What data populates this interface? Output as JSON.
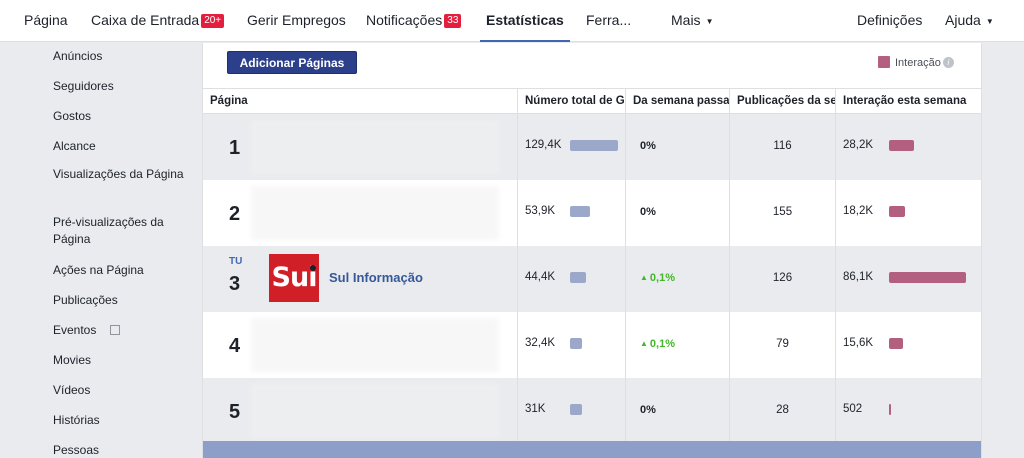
{
  "nav": {
    "items": [
      {
        "label": "Página"
      },
      {
        "label": "Caixa de Entrada",
        "badge": "20+"
      },
      {
        "label": "Gerir Empregos"
      },
      {
        "label": "Notificações",
        "badge": "33"
      },
      {
        "label": "Estatísticas"
      },
      {
        "label": "Ferra..."
      },
      {
        "label": "Mais"
      },
      {
        "label": "Definições"
      },
      {
        "label": "Ajuda"
      }
    ],
    "active_color": "#4267b2",
    "badge_color": "#e41e3f"
  },
  "sidebar": {
    "items": [
      {
        "label": "Anúncios"
      },
      {
        "label": "Seguidores"
      },
      {
        "label": "Gostos"
      },
      {
        "label": "Alcance"
      },
      {
        "label": "Visualizações da Página"
      },
      {
        "label": "Pré-visualizações da Página"
      },
      {
        "label": "Ações na Página"
      },
      {
        "label": "Publicações"
      },
      {
        "label": "Eventos",
        "icon": "external-link-icon"
      },
      {
        "label": "Movies"
      },
      {
        "label": "Vídeos"
      },
      {
        "label": "Histórias"
      },
      {
        "label": "Pessoas"
      }
    ]
  },
  "main": {
    "add_button": "Adicionar Páginas",
    "legend_label": "Interação",
    "headers": [
      "Página",
      "Número total de G",
      "Da semana passa",
      "Publicações da se",
      "Interação esta semana"
    ],
    "rows": [
      {
        "rank": "1",
        "tag": "",
        "name": "",
        "total": "129,4K",
        "total_fraction": 1.0,
        "change": "0%",
        "change_up": false,
        "posts": "116",
        "interaction": "28,2K",
        "interaction_fraction": 0.33
      },
      {
        "rank": "2",
        "tag": "",
        "name": "",
        "total": "53,9K",
        "total_fraction": 0.42,
        "change": "0%",
        "change_up": false,
        "posts": "155",
        "interaction": "18,2K",
        "interaction_fraction": 0.21
      },
      {
        "rank": "3",
        "tag": "TU",
        "name": "Sul Informação",
        "logo_text": "Sui",
        "total": "44,4K",
        "total_fraction": 0.34,
        "change": "0,1%",
        "change_up": true,
        "posts": "126",
        "interaction": "86,1K",
        "interaction_fraction": 1.0
      },
      {
        "rank": "4",
        "tag": "",
        "name": "",
        "total": "32,4K",
        "total_fraction": 0.25,
        "change": "0,1%",
        "change_up": true,
        "posts": "79",
        "interaction": "15,6K",
        "interaction_fraction": 0.18
      },
      {
        "rank": "5",
        "tag": "",
        "name": "",
        "total": "31K",
        "total_fraction": 0.24,
        "change": "0%",
        "change_up": false,
        "posts": "28",
        "interaction": "502",
        "interaction_fraction": 0.01
      }
    ],
    "colors": {
      "total_bar": "#9ca8c9",
      "interaction_bar": "#b36080",
      "up": "#42b72a",
      "button": "#2b3f8a"
    }
  }
}
